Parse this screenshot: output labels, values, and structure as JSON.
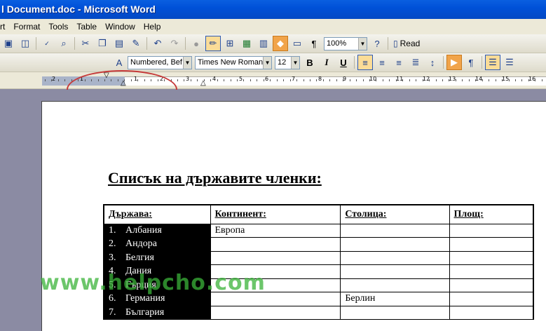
{
  "window": {
    "title": "l Document.doc - Microsoft Word"
  },
  "menu": [
    "rt",
    "Format",
    "Tools",
    "Table",
    "Window",
    "Help"
  ],
  "toolbar1": {
    "zoom": "100%",
    "read_label": "Read"
  },
  "toolbar2": {
    "style": "Numbered, Bef",
    "font": "Times New Roman",
    "size": "12",
    "bold": "B",
    "italic": "I",
    "underline": "U"
  },
  "ruler": {
    "numbers": [
      "2",
      "1",
      "1",
      "2",
      "3",
      "4",
      "5",
      "6",
      "7",
      "8",
      "9",
      "10",
      "11",
      "12",
      "13",
      "14",
      "15",
      "16"
    ]
  },
  "document": {
    "heading": "Списък на държавите членки:",
    "table": {
      "headers": [
        "Държава:",
        "Континент:",
        "Столица:",
        "Площ:"
      ],
      "rows": [
        {
          "num": "1.",
          "country": "Албания",
          "continent": "Европа",
          "capital": "",
          "area": ""
        },
        {
          "num": "2.",
          "country": "Андора",
          "continent": "",
          "capital": "",
          "area": ""
        },
        {
          "num": "3.",
          "country": "Белгия",
          "continent": "",
          "capital": "",
          "area": ""
        },
        {
          "num": "4.",
          "country": "Дания",
          "continent": "",
          "capital": "",
          "area": ""
        },
        {
          "num": "5.",
          "country": "Гърция",
          "continent": "",
          "capital": "",
          "area": ""
        },
        {
          "num": "6.",
          "country": "Германия",
          "continent": "",
          "capital": "Берлин",
          "area": ""
        },
        {
          "num": "7.",
          "country": "България",
          "continent": "",
          "capital": "",
          "area": ""
        }
      ]
    }
  },
  "watermark": "www.helpcho.com",
  "colors": {
    "titlebar": "#0a5fe0",
    "menu_bg": "#ece9d8",
    "callout": "#c63a3a",
    "watermark": "#3bb33a",
    "selection": "#000000"
  }
}
